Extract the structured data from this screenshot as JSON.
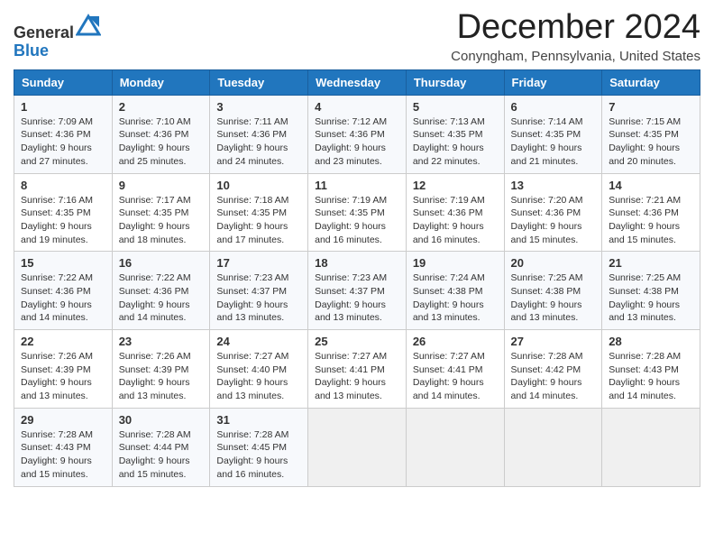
{
  "header": {
    "logo_line1": "General",
    "logo_line2": "Blue",
    "month_title": "December 2024",
    "location": "Conyngham, Pennsylvania, United States"
  },
  "weekdays": [
    "Sunday",
    "Monday",
    "Tuesday",
    "Wednesday",
    "Thursday",
    "Friday",
    "Saturday"
  ],
  "weeks": [
    [
      {
        "day": "1",
        "sunrise": "7:09 AM",
        "sunset": "4:36 PM",
        "daylight": "9 hours and 27 minutes."
      },
      {
        "day": "2",
        "sunrise": "7:10 AM",
        "sunset": "4:36 PM",
        "daylight": "9 hours and 25 minutes."
      },
      {
        "day": "3",
        "sunrise": "7:11 AM",
        "sunset": "4:36 PM",
        "daylight": "9 hours and 24 minutes."
      },
      {
        "day": "4",
        "sunrise": "7:12 AM",
        "sunset": "4:36 PM",
        "daylight": "9 hours and 23 minutes."
      },
      {
        "day": "5",
        "sunrise": "7:13 AM",
        "sunset": "4:35 PM",
        "daylight": "9 hours and 22 minutes."
      },
      {
        "day": "6",
        "sunrise": "7:14 AM",
        "sunset": "4:35 PM",
        "daylight": "9 hours and 21 minutes."
      },
      {
        "day": "7",
        "sunrise": "7:15 AM",
        "sunset": "4:35 PM",
        "daylight": "9 hours and 20 minutes."
      }
    ],
    [
      {
        "day": "8",
        "sunrise": "7:16 AM",
        "sunset": "4:35 PM",
        "daylight": "9 hours and 19 minutes."
      },
      {
        "day": "9",
        "sunrise": "7:17 AM",
        "sunset": "4:35 PM",
        "daylight": "9 hours and 18 minutes."
      },
      {
        "day": "10",
        "sunrise": "7:18 AM",
        "sunset": "4:35 PM",
        "daylight": "9 hours and 17 minutes."
      },
      {
        "day": "11",
        "sunrise": "7:19 AM",
        "sunset": "4:35 PM",
        "daylight": "9 hours and 16 minutes."
      },
      {
        "day": "12",
        "sunrise": "7:19 AM",
        "sunset": "4:36 PM",
        "daylight": "9 hours and 16 minutes."
      },
      {
        "day": "13",
        "sunrise": "7:20 AM",
        "sunset": "4:36 PM",
        "daylight": "9 hours and 15 minutes."
      },
      {
        "day": "14",
        "sunrise": "7:21 AM",
        "sunset": "4:36 PM",
        "daylight": "9 hours and 15 minutes."
      }
    ],
    [
      {
        "day": "15",
        "sunrise": "7:22 AM",
        "sunset": "4:36 PM",
        "daylight": "9 hours and 14 minutes."
      },
      {
        "day": "16",
        "sunrise": "7:22 AM",
        "sunset": "4:36 PM",
        "daylight": "9 hours and 14 minutes."
      },
      {
        "day": "17",
        "sunrise": "7:23 AM",
        "sunset": "4:37 PM",
        "daylight": "9 hours and 13 minutes."
      },
      {
        "day": "18",
        "sunrise": "7:23 AM",
        "sunset": "4:37 PM",
        "daylight": "9 hours and 13 minutes."
      },
      {
        "day": "19",
        "sunrise": "7:24 AM",
        "sunset": "4:38 PM",
        "daylight": "9 hours and 13 minutes."
      },
      {
        "day": "20",
        "sunrise": "7:25 AM",
        "sunset": "4:38 PM",
        "daylight": "9 hours and 13 minutes."
      },
      {
        "day": "21",
        "sunrise": "7:25 AM",
        "sunset": "4:38 PM",
        "daylight": "9 hours and 13 minutes."
      }
    ],
    [
      {
        "day": "22",
        "sunrise": "7:26 AM",
        "sunset": "4:39 PM",
        "daylight": "9 hours and 13 minutes."
      },
      {
        "day": "23",
        "sunrise": "7:26 AM",
        "sunset": "4:39 PM",
        "daylight": "9 hours and 13 minutes."
      },
      {
        "day": "24",
        "sunrise": "7:27 AM",
        "sunset": "4:40 PM",
        "daylight": "9 hours and 13 minutes."
      },
      {
        "day": "25",
        "sunrise": "7:27 AM",
        "sunset": "4:41 PM",
        "daylight": "9 hours and 13 minutes."
      },
      {
        "day": "26",
        "sunrise": "7:27 AM",
        "sunset": "4:41 PM",
        "daylight": "9 hours and 14 minutes."
      },
      {
        "day": "27",
        "sunrise": "7:28 AM",
        "sunset": "4:42 PM",
        "daylight": "9 hours and 14 minutes."
      },
      {
        "day": "28",
        "sunrise": "7:28 AM",
        "sunset": "4:43 PM",
        "daylight": "9 hours and 14 minutes."
      }
    ],
    [
      {
        "day": "29",
        "sunrise": "7:28 AM",
        "sunset": "4:43 PM",
        "daylight": "9 hours and 15 minutes."
      },
      {
        "day": "30",
        "sunrise": "7:28 AM",
        "sunset": "4:44 PM",
        "daylight": "9 hours and 15 minutes."
      },
      {
        "day": "31",
        "sunrise": "7:28 AM",
        "sunset": "4:45 PM",
        "daylight": "9 hours and 16 minutes."
      },
      null,
      null,
      null,
      null
    ]
  ],
  "labels": {
    "sunrise": "Sunrise:",
    "sunset": "Sunset:",
    "daylight": "Daylight:"
  }
}
